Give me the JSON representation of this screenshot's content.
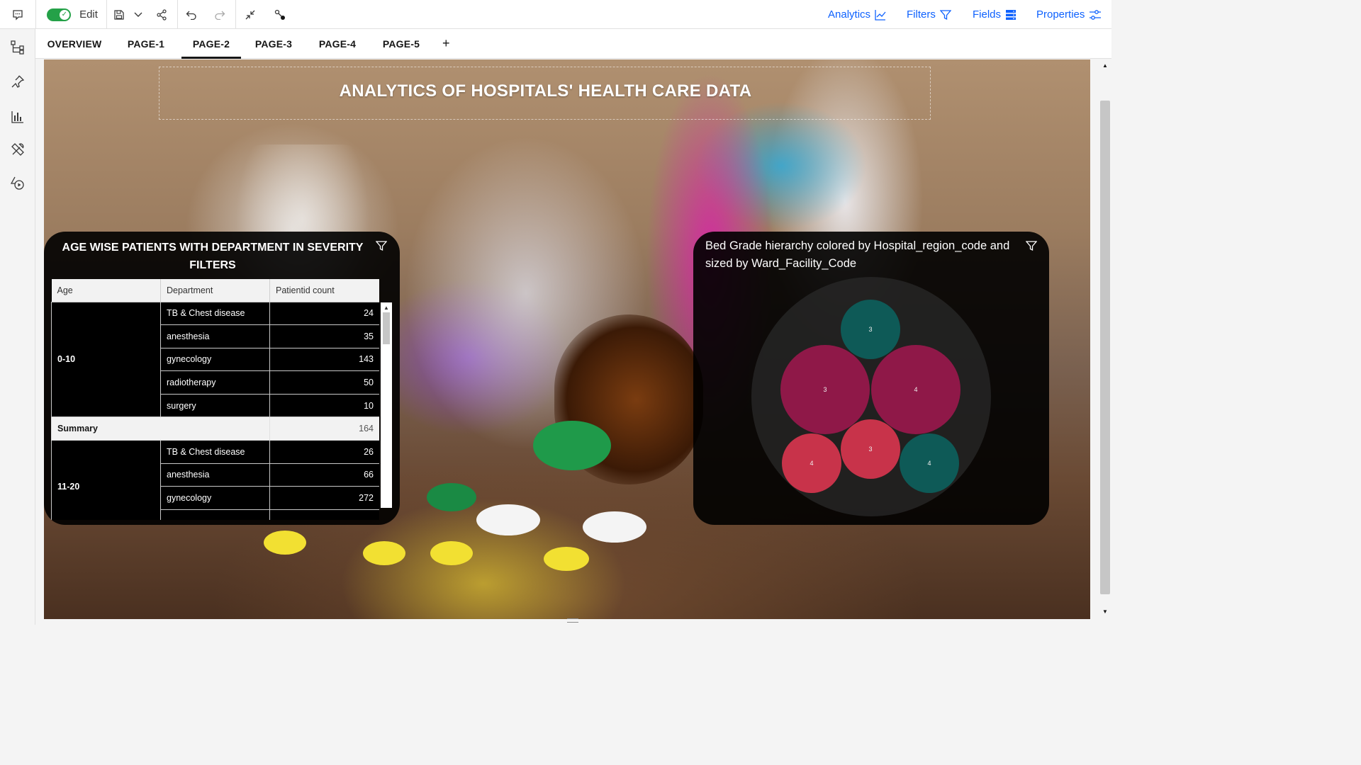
{
  "toolbar": {
    "edit_label": "Edit",
    "right_menu": [
      {
        "label": "Analytics",
        "icon": "line-chart-icon"
      },
      {
        "label": "Filters",
        "icon": "filter-icon"
      },
      {
        "label": "Fields",
        "icon": "fields-icon"
      },
      {
        "label": "Properties",
        "icon": "sliders-icon"
      }
    ]
  },
  "tabs": [
    {
      "label": "OVERVIEW"
    },
    {
      "label": "PAGE-1"
    },
    {
      "label": "PAGE-2",
      "active": true
    },
    {
      "label": "PAGE-3"
    },
    {
      "label": "PAGE-4"
    },
    {
      "label": "PAGE-5"
    }
  ],
  "add_tab_label": "+",
  "report": {
    "title": "ANALYTICS OF HOSPITALS' HEALTH CARE DATA"
  },
  "table_panel": {
    "title": "AGE WISE PATIENTS WITH DEPARTMENT IN SEVERITY FILTERS",
    "columns": [
      "Age",
      "Department",
      "Patientid count"
    ],
    "groups": [
      {
        "age": "0-10",
        "rows": [
          {
            "department": "TB & Chest disease",
            "count": "24"
          },
          {
            "department": "anesthesia",
            "count": "35"
          },
          {
            "department": "gynecology",
            "count": "143"
          },
          {
            "department": "radiotherapy",
            "count": "50"
          },
          {
            "department": "surgery",
            "count": "10"
          }
        ],
        "summary_label": "Summary",
        "summary_value": "164"
      },
      {
        "age": "11-20",
        "rows": [
          {
            "department": "TB & Chest disease",
            "count": "26"
          },
          {
            "department": "anesthesia",
            "count": "66"
          },
          {
            "department": "gynecology",
            "count": "272"
          }
        ]
      }
    ]
  },
  "bubble_panel": {
    "title": "Bed Grade hierarchy colored by Hospital_region_code and sized by Ward_Facility_Code"
  },
  "chart_data": {
    "type": "packed-bubble",
    "title": "Bed Grade hierarchy colored by Hospital_region_code and sized by Ward_Facility_Code",
    "bubbles": [
      {
        "label": "3",
        "color": "#0e5a57"
      },
      {
        "label": "3",
        "color": "#8f1848"
      },
      {
        "label": "4",
        "color": "#8f1848"
      },
      {
        "label": "3",
        "color": "#c8334a"
      },
      {
        "label": "4",
        "color": "#c8334a"
      },
      {
        "label": "4",
        "color": "#0e5a57"
      }
    ]
  },
  "colors": {
    "toggle_on": "#24a148",
    "link_blue": "#0f62fe",
    "panel_bg": "#000000"
  }
}
